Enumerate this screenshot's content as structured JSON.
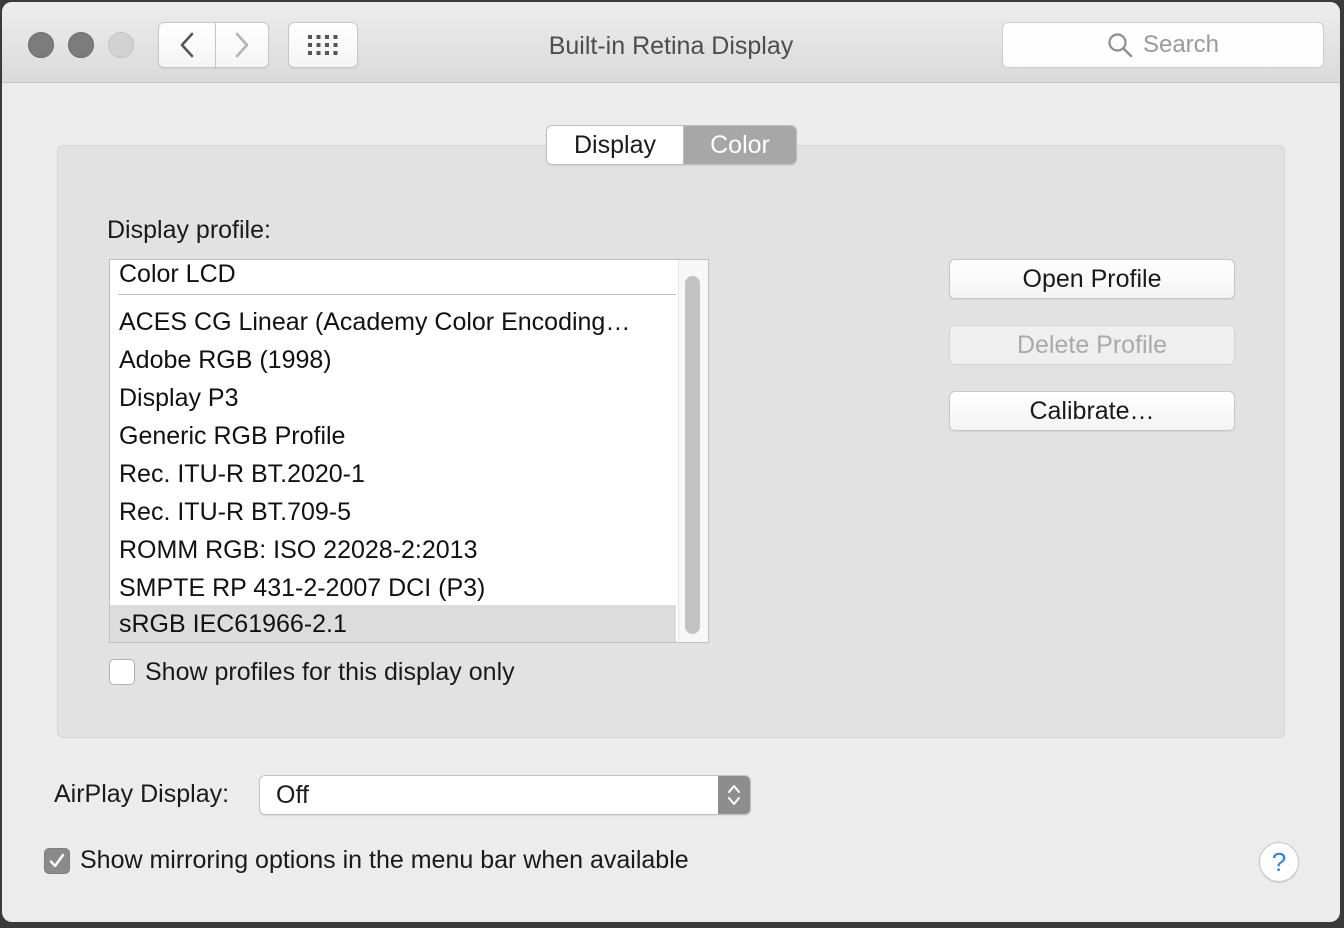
{
  "window": {
    "title": "Built-in Retina Display"
  },
  "toolbar": {
    "back_icon": "chevron-left-icon",
    "forward_icon": "chevron-right-icon",
    "grid_icon": "grid-icon",
    "search_placeholder": "Search"
  },
  "tabs": [
    {
      "label": "Display",
      "selected": false
    },
    {
      "label": "Color",
      "selected": true
    }
  ],
  "color_tab": {
    "profile_label": "Display profile:",
    "profiles": [
      "Color LCD",
      "ACES CG Linear (Academy Color Encoding…",
      "Adobe RGB (1998)",
      "Display P3",
      "Generic RGB Profile",
      "Rec. ITU-R BT.2020-1",
      "Rec. ITU-R BT.709-5",
      "ROMM RGB: ISO 22028-2:2013",
      "SMPTE RP 431-2-2007 DCI (P3)",
      "sRGB IEC61966-2.1"
    ],
    "selected_profile": "sRGB IEC61966-2.1",
    "show_profiles_label": "Show profiles for this display only",
    "show_profiles_checked": false,
    "open_profile_label": "Open Profile",
    "delete_profile_label": "Delete Profile",
    "calibrate_label": "Calibrate…"
  },
  "airplay": {
    "label": "AirPlay Display:",
    "value": "Off"
  },
  "mirroring": {
    "label": "Show mirroring options in the menu bar when available",
    "checked": true
  },
  "help": {
    "symbol": "?"
  },
  "colors": {
    "window_bg": "#ececec",
    "selected_tab": "#a7a7a7",
    "help_blue": "#2f7ff0"
  }
}
